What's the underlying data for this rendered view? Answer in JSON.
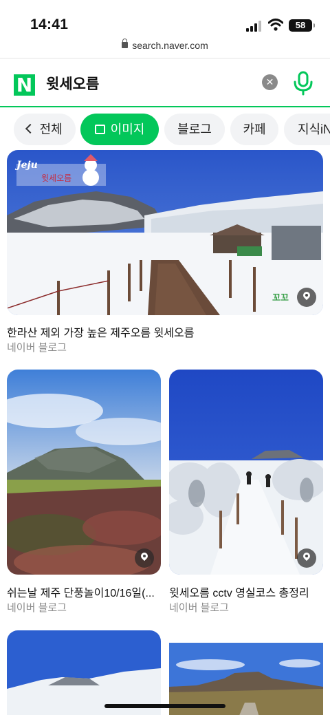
{
  "status_bar": {
    "time": "14:41",
    "battery": "58"
  },
  "browser": {
    "url": "search.naver.com"
  },
  "search": {
    "logo": "N",
    "query": "윗세오름",
    "clear_icon": "clear-icon",
    "mic_icon": "mic-icon"
  },
  "tabs": [
    {
      "label": "전체",
      "active": false
    },
    {
      "label": "이미지",
      "active": true
    },
    {
      "label": "블로그",
      "active": false
    },
    {
      "label": "카페",
      "active": false
    },
    {
      "label": "지식iN",
      "active": false
    }
  ],
  "results": [
    {
      "caption": "한라산 제외 가장 높은 제주오름 윗세오름",
      "source": "네이버 블로그",
      "overlay_title": "Jeju",
      "overlay_sub": "윗세오름",
      "watermark": "꼬꼬"
    },
    {
      "caption": "쉬는날 제주 단풍놀이10/16일(...",
      "source": "네이버 블로그"
    },
    {
      "caption": "윗세오름 cctv 영실코스 총정리",
      "source": "네이버 블로그"
    }
  ],
  "colors": {
    "accent": "#03c75a"
  }
}
